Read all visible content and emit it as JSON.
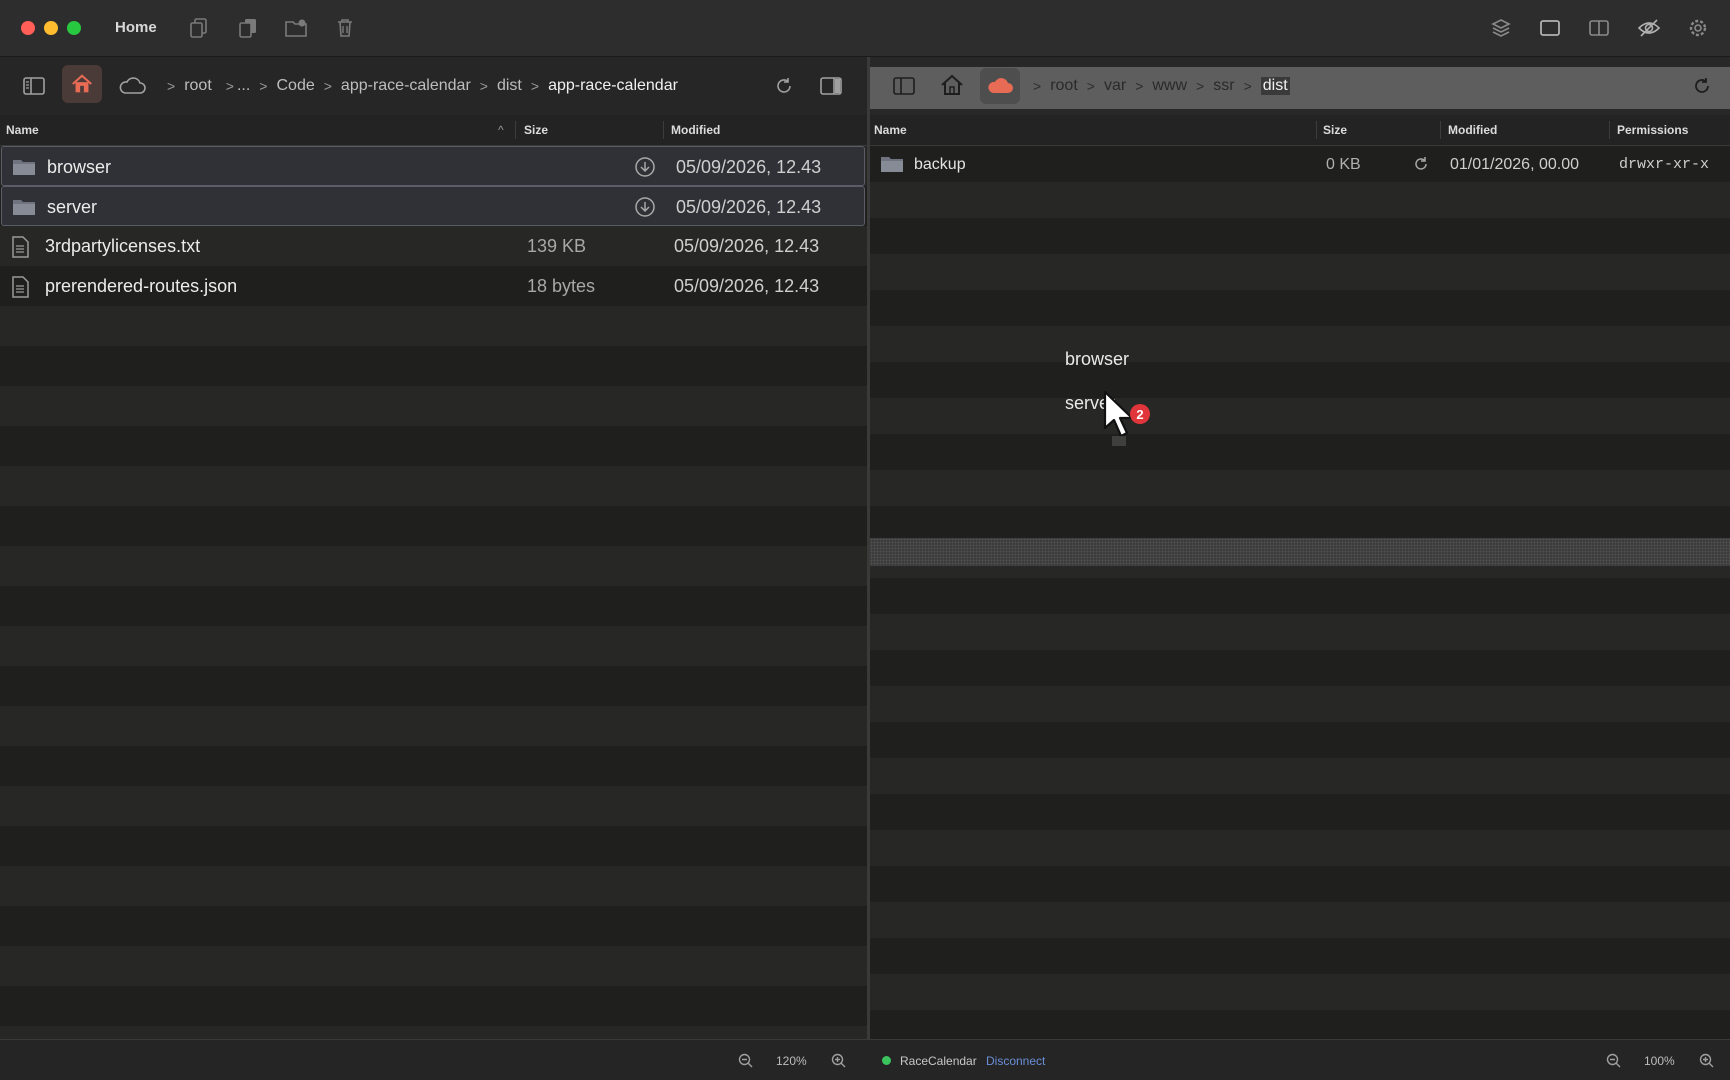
{
  "window": {
    "title": "Home"
  },
  "left_pane": {
    "breadcrumbs": [
      "root",
      "...",
      "Code",
      "app-race-calendar",
      "dist",
      "app-race-calendar"
    ],
    "columns": {
      "name": "Name",
      "size": "Size",
      "modified": "Modified"
    },
    "files": [
      {
        "name": "browser",
        "size": "",
        "modified": "05/09/2026, 12.43",
        "type": "folder",
        "selected": true
      },
      {
        "name": "server",
        "size": "",
        "modified": "05/09/2026, 12.43",
        "type": "folder",
        "selected": true
      },
      {
        "name": "3rdpartylicenses.txt",
        "size": "139 KB",
        "modified": "05/09/2026, 12.43",
        "type": "file",
        "selected": false
      },
      {
        "name": "prerendered-routes.json",
        "size": "18 bytes",
        "modified": "05/09/2026, 12.43",
        "type": "file",
        "selected": false
      }
    ],
    "zoom": "120%"
  },
  "right_pane": {
    "breadcrumbs": [
      "root",
      "var",
      "www",
      "ssr",
      "dist"
    ],
    "columns": {
      "name": "Name",
      "size": "Size",
      "modified": "Modified",
      "permissions": "Permissions"
    },
    "files": [
      {
        "name": "backup",
        "size": "0 KB",
        "modified": "01/01/2026, 00.00",
        "permissions": "drwxr-xr-x",
        "type": "folder"
      }
    ],
    "drag": {
      "items": [
        "browser",
        "server"
      ],
      "count": "2"
    },
    "connection": {
      "name": "RaceCalendar",
      "action": "Disconnect",
      "status_color": "#3bc45d"
    },
    "zoom": "100%"
  },
  "colors": {
    "accent": "#e0353b",
    "home_icon": "#e86c55",
    "link": "#6a8fd8"
  }
}
